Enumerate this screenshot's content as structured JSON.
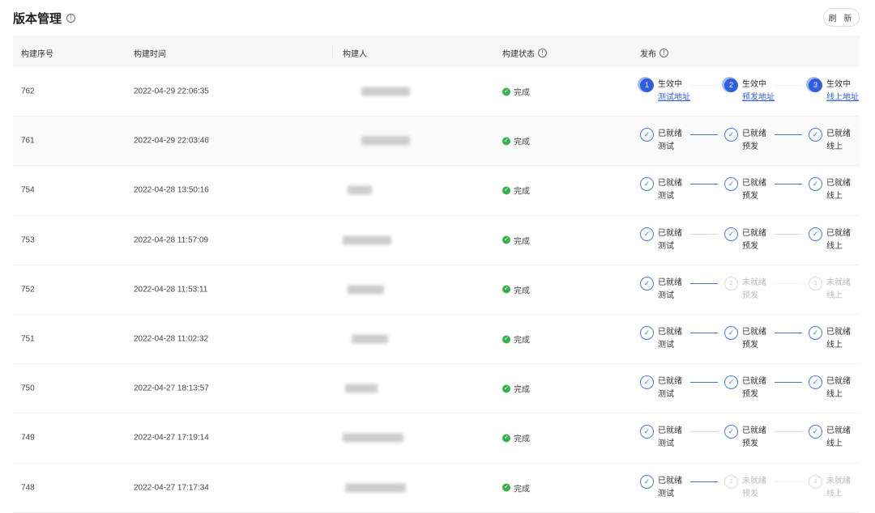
{
  "header": {
    "title": "版本管理",
    "refresh_label": "刷 新"
  },
  "columns": [
    "构建序号",
    "构建时间",
    "构建人",
    "构建状态",
    "发布"
  ],
  "status_color": "#36b24a",
  "accent": "#2d5fe0",
  "stage_names": [
    "测试",
    "预发",
    "线上"
  ],
  "link_labels": [
    "测试地址",
    "预发地址",
    "线上地址"
  ],
  "state_labels": {
    "active": "生效中",
    "ready": "已就绪",
    "pending": "未就绪"
  },
  "rows": [
    {
      "id": "762",
      "time": "2022-04-29 22:06:35",
      "status": "完成",
      "steps": [
        "active",
        "active",
        "active"
      ],
      "lines": [
        "faint",
        "faint"
      ]
    },
    {
      "id": "761",
      "time": "2022-04-29 22:03:46",
      "status": "完成",
      "steps": [
        "ready",
        "ready",
        "ready"
      ],
      "lines": [
        "dark",
        "dark"
      ]
    },
    {
      "id": "754",
      "time": "2022-04-28 13:50:16",
      "status": "完成",
      "steps": [
        "ready",
        "ready",
        "ready"
      ],
      "lines": [
        "dark",
        "dark"
      ]
    },
    {
      "id": "753",
      "time": "2022-04-28 11:57:09",
      "status": "完成",
      "steps": [
        "ready",
        "ready",
        "ready"
      ],
      "lines": [
        "light",
        "light"
      ]
    },
    {
      "id": "752",
      "time": "2022-04-28 11:53:11",
      "status": "完成",
      "steps": [
        "ready",
        "pending",
        "pending"
      ],
      "lines": [
        "dark",
        "faint"
      ]
    },
    {
      "id": "751",
      "time": "2022-04-28 11:02:32",
      "status": "完成",
      "steps": [
        "ready",
        "ready",
        "ready"
      ],
      "lines": [
        "dark",
        "dark"
      ]
    },
    {
      "id": "750",
      "time": "2022-04-27 18:13:57",
      "status": "完成",
      "steps": [
        "ready",
        "ready",
        "ready"
      ],
      "lines": [
        "dark",
        "dark"
      ]
    },
    {
      "id": "749",
      "time": "2022-04-27 17:19:14",
      "status": "完成",
      "steps": [
        "ready",
        "ready",
        "ready"
      ],
      "lines": [
        "light",
        "light"
      ]
    },
    {
      "id": "748",
      "time": "2022-04-27 17:17:34",
      "status": "完成",
      "steps": [
        "ready",
        "pending",
        "pending"
      ],
      "lines": [
        "dark",
        "faint"
      ]
    }
  ]
}
